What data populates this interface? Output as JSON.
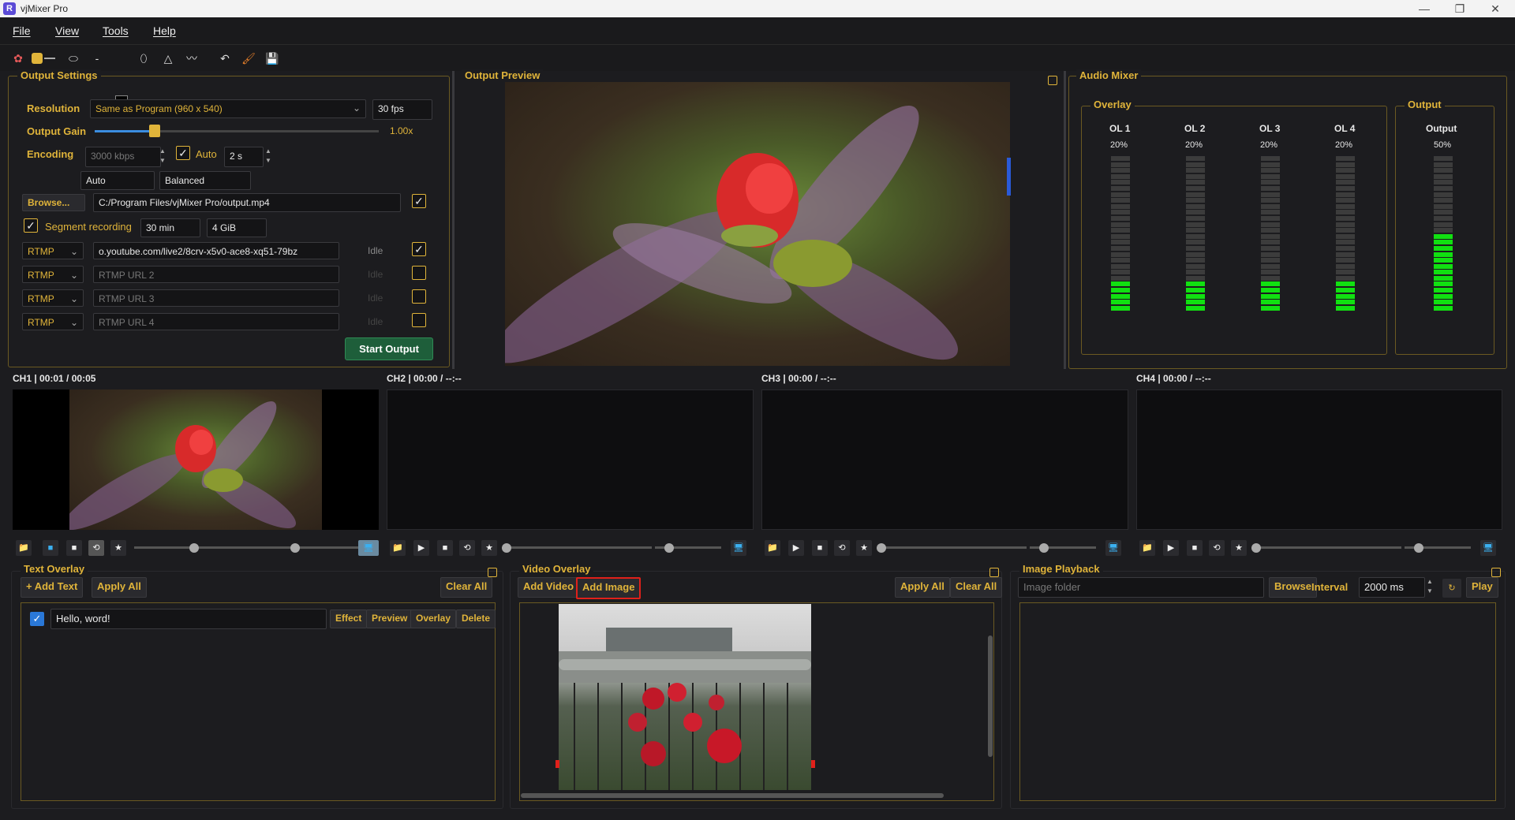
{
  "window": {
    "title": "vjMixer Pro",
    "minimize": "—",
    "maximize": "❐",
    "close": "✕"
  },
  "menu": [
    "File",
    "View",
    "Tools",
    "Help"
  ],
  "output_settings": {
    "title": "Output Settings",
    "resolution_label": "Resolution",
    "resolution_value": "Same as Program (960 x 540)",
    "fps": "30 fps",
    "gain_label": "Output Gain",
    "gain_value": "1.00x",
    "gain_level": 0.21,
    "encoding_label": "Encoding",
    "bitrate": "3000 kbps",
    "auto_label": "Auto",
    "keyframe": "2 s",
    "rate_mode": "Auto",
    "preset": "Balanced",
    "browse_label": "Browse...",
    "output_path": "C:/Program Files/vjMixer Pro/output.mp4",
    "segment_label": "Segment recording",
    "segment_time": "30 min",
    "segment_size": "4 GiB",
    "rtmp_rows": [
      {
        "proto": "RTMP",
        "url": "o.youtube.com/live2/8crv-x5v0-ace8-xq51-79bz",
        "status": "Idle",
        "checked": "✓"
      },
      {
        "proto": "RTMP",
        "url": "RTMP URL 2",
        "status": "Idle",
        "checked": ""
      },
      {
        "proto": "RTMP",
        "url": "RTMP URL 3",
        "status": "Idle",
        "checked": ""
      },
      {
        "proto": "RTMP",
        "url": "RTMP URL 4",
        "status": "Idle",
        "checked": ""
      }
    ],
    "start_output": "Start Output"
  },
  "output_preview": {
    "title": "Output Preview"
  },
  "audio_mixer": {
    "title": "Audio Mixer",
    "overlay_group": "Overlay",
    "output_group": "Output",
    "channels": [
      {
        "name": "OL 1",
        "level": "20%"
      },
      {
        "name": "OL 2",
        "level": "20%"
      },
      {
        "name": "OL 3",
        "level": "20%"
      },
      {
        "name": "OL 4",
        "level": "20%"
      }
    ],
    "output": {
      "name": "Output",
      "level": "50%"
    }
  },
  "channels": [
    {
      "label": "CH1 | 00:01 / 00:05"
    },
    {
      "label": "CH2 | 00:00 / --:--"
    },
    {
      "label": "CH3 | 00:00 / --:--"
    },
    {
      "label": "CH4 | 00:00 / --:--"
    }
  ],
  "text_overlay": {
    "title": "Text Overlay",
    "add_text": "+ Add Text",
    "apply_all": "Apply All",
    "clear_all": "Clear All",
    "item_text": "Hello, word!",
    "effect": "Effect",
    "preview": "Preview",
    "overlay": "Overlay",
    "delete": "Delete"
  },
  "video_overlay": {
    "title": "Video Overlay",
    "add_video": "Add Video",
    "add_image": "Add Image",
    "apply_all": "Apply All",
    "clear_all": "Clear All"
  },
  "image_playback": {
    "title": "Image Playback",
    "folder_placeholder": "Image folder",
    "browse": "Browse",
    "interval_label": "Interval",
    "interval_value": "2000 ms",
    "play": "Play"
  }
}
